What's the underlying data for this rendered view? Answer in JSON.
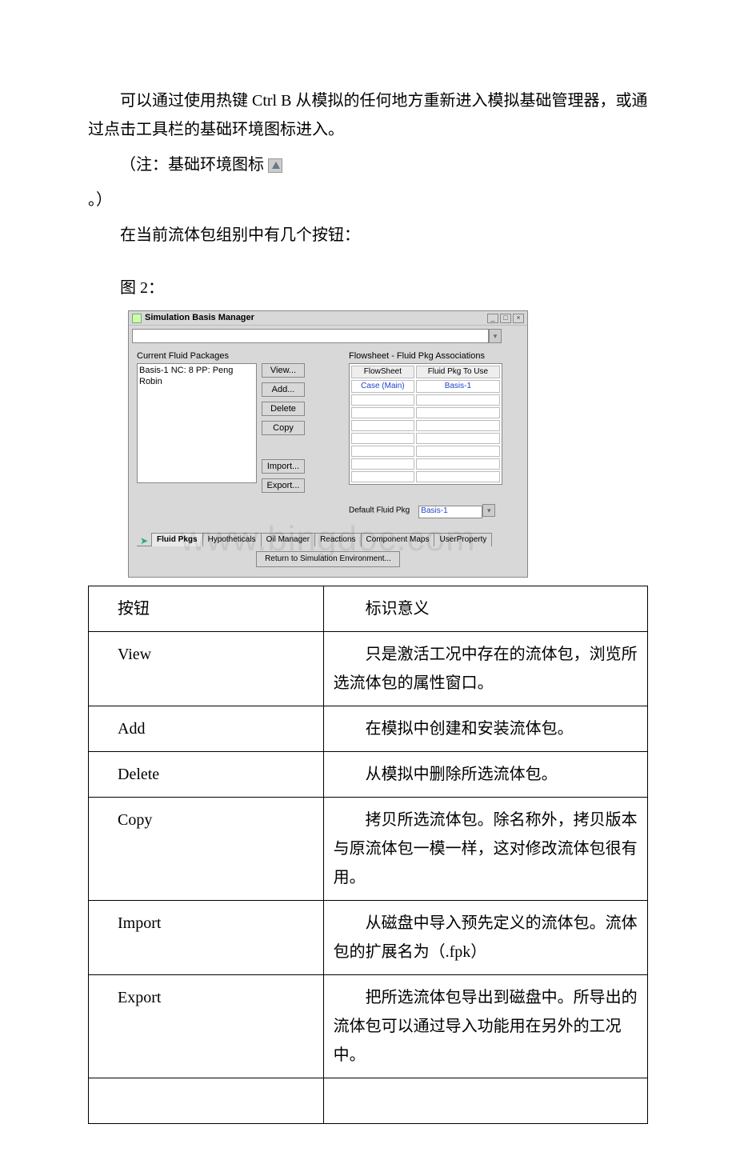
{
  "paragraphs": {
    "p1": "可以通过使用热键 Ctrl B 从模拟的任何地方重新进入模拟基础管理器，或通过点击工具栏的基础环境图标进入。",
    "p2a": "（注：基础环境图标 ",
    "p2b": "。）",
    "p3": "在当前流体包组别中有几个按钮：",
    "fig": "图 2："
  },
  "sim": {
    "title": "Simulation Basis Manager",
    "group_left": "Current Fluid Packages",
    "list_item": "Basis-1     NC: 8    PP: Peng Robin",
    "buttons": {
      "view": "View...",
      "add": "Add...",
      "delete": "Delete",
      "copy": "Copy",
      "import": "Import...",
      "export": "Export..."
    },
    "group_right": "Flowsheet - Fluid Pkg Associations",
    "assoc_headers": {
      "flow": "FlowSheet",
      "pkg": "Fluid Pkg To Use"
    },
    "assoc_row": {
      "flow": "Case (Main)",
      "pkg": "Basis-1"
    },
    "default_label": "Default Fluid Pkg",
    "default_value": "Basis-1",
    "tabs": {
      "t1": "Fluid Pkgs",
      "t2": "Hypotheticals",
      "t3": "Oil Manager",
      "t4": "Reactions",
      "t5": "Component Maps",
      "t6": "UserProperty"
    },
    "return_btn": "Return to Simulation Environment...",
    "watermark": "www.bingdoc.com"
  },
  "table": {
    "header": {
      "btn": "按钮",
      "meaning": "标识意义"
    },
    "rows": [
      {
        "btn": "View",
        "meaning": "只是激活工况中存在的流体包，浏览所选流体包的属性窗口。"
      },
      {
        "btn": "Add",
        "meaning": "在模拟中创建和安装流体包。"
      },
      {
        "btn": "Delete",
        "meaning": "从模拟中删除所选流体包。"
      },
      {
        "btn": "Copy",
        "meaning": "拷贝所选流体包。除名称外，拷贝版本与原流体包一模一样，这对修改流体包很有用。"
      },
      {
        "btn": "Import",
        "meaning": "从磁盘中导入预先定义的流体包。流体包的扩展名为（.fpk）"
      },
      {
        "btn": "Export",
        "meaning": "把所选流体包导出到磁盘中。所导出的流体包可以通过导入功能用在另外的工况中。"
      }
    ]
  }
}
